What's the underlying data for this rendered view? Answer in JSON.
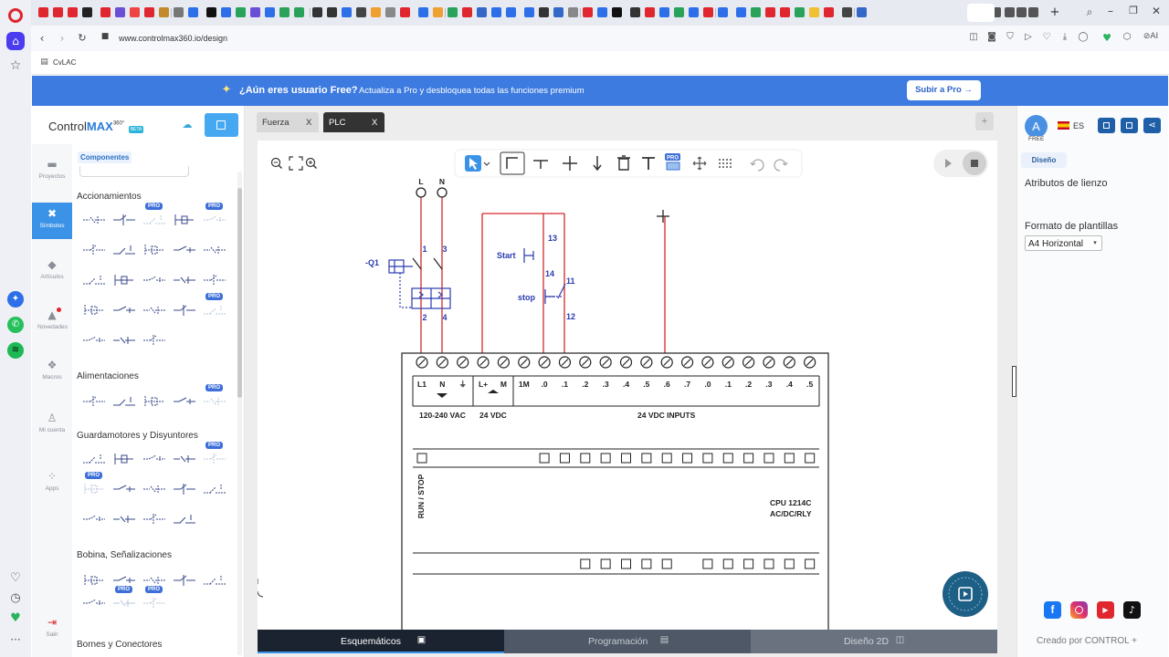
{
  "browser": {
    "url": "www.controlmax360.io/design",
    "bookmark": "CvLAC"
  },
  "banner": {
    "icon": "sparkle-icon",
    "title": "¿Aún eres usuario Free?",
    "text": "Actualiza a Pro y desbloquea todas las funciones premium",
    "button": "Subir a Pro →"
  },
  "brand": {
    "name_a": "Control",
    "name_b": "MAX",
    "sup": "360°",
    "badge": "BETA"
  },
  "leftnav": {
    "items": [
      {
        "label": "Proyectos",
        "icon": "folder-icon"
      },
      {
        "label": "Símbolos",
        "icon": "tools-icon"
      },
      {
        "label": "Artículos",
        "icon": "cube-icon"
      },
      {
        "label": "Novedades",
        "icon": "bell-icon"
      },
      {
        "label": "Macros",
        "icon": "macros-icon"
      },
      {
        "label": "Mi cuenta",
        "icon": "user-icon"
      },
      {
        "label": "Apps",
        "icon": "apps-icon"
      },
      {
        "label": "Salir",
        "icon": "logout-icon"
      }
    ]
  },
  "components": {
    "tab": "Componentes",
    "pro_badge": "PRO",
    "sections": [
      {
        "title": "Accionamientos"
      },
      {
        "title": "Alimentaciones"
      },
      {
        "title": "Guardamotores y Disyuntores"
      },
      {
        "title": "Bobina, Señalizaciones"
      },
      {
        "title": "Bornes y Conectores"
      }
    ]
  },
  "tabs": [
    {
      "label": "Fuerza",
      "close": "X"
    },
    {
      "label": "PLC",
      "close": "X"
    }
  ],
  "add_tab": "+",
  "toolbar": {
    "pro_badge": "PRO"
  },
  "schematic": {
    "supply": [
      "L",
      "N"
    ],
    "breaker": {
      "label": "-Q1",
      "terminals": [
        "1",
        "3",
        "2",
        "4"
      ]
    },
    "start": {
      "label": "Start",
      "terminals": [
        "13",
        "14"
      ]
    },
    "stop": {
      "label": "stop",
      "terminals": [
        "11",
        "12"
      ]
    },
    "plc": {
      "top_terms": [
        "L1",
        "N",
        "⏚",
        "L+",
        "M",
        "1M",
        ".0",
        ".1",
        ".2",
        ".3",
        ".4",
        ".5",
        ".6",
        ".7",
        ".0",
        ".1",
        ".2",
        ".3",
        ".4",
        ".5"
      ],
      "supply_ac": "120-240 VAC",
      "supply_dc": "24 VDC",
      "inputs": "24 VDC INPUTS",
      "run_stop": "RUN / STOP",
      "model_a": "CPU 1214C",
      "model_b": "AC/DC/RLY"
    }
  },
  "bottom_tabs": [
    {
      "label": "Esquemáticos"
    },
    {
      "label": "Programación"
    },
    {
      "label": "Diseño 2D"
    }
  ],
  "right": {
    "avatar": "A",
    "plan": "FREE",
    "lang": "ES",
    "tab": "Diseño",
    "heading": "Atributos de lienzo",
    "template_label": "Formato de plantillas",
    "template_value": "A4 Horizontal",
    "footer": "Creado por CONTROL +"
  },
  "colors": {
    "banner": "#3d7be0",
    "wire": "#d62828",
    "symbol": "#2a3bb0",
    "active_tab": "#333333",
    "bottom_bar": "#1b2330"
  }
}
